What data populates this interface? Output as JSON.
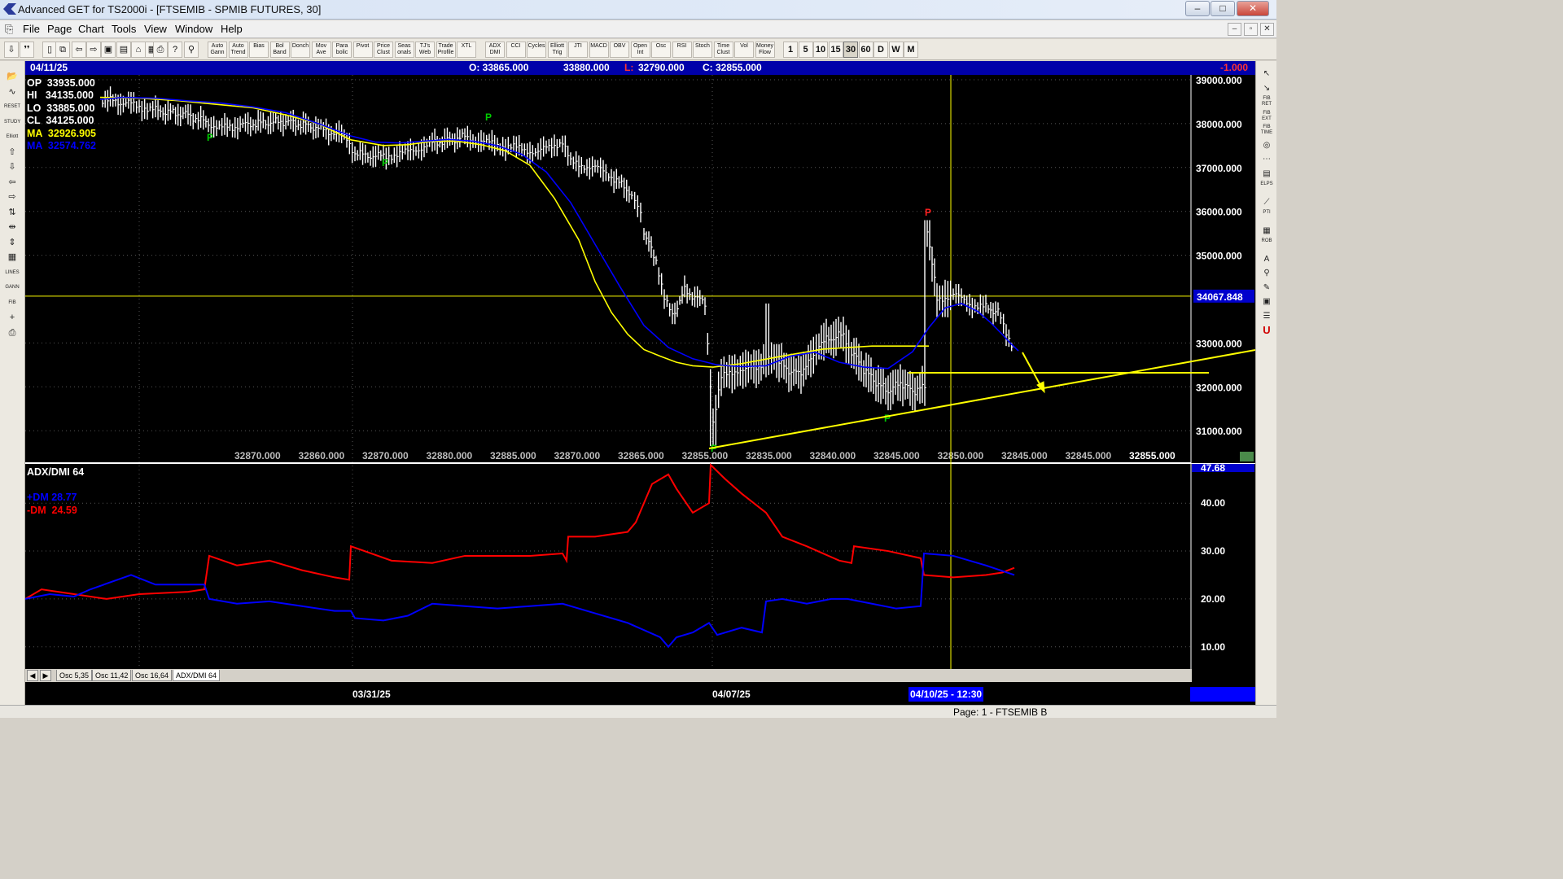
{
  "window": {
    "title": "Advanced GET for TS2000i - [FTSEMIB - SPMIB FUTURES, 30]",
    "min": "–",
    "max": "□",
    "close": "✕"
  },
  "menu": {
    "items": [
      "File",
      "Page",
      "Chart",
      "Tools",
      "View",
      "Window",
      "Help"
    ],
    "mdi": [
      "–",
      "▫",
      "✕"
    ]
  },
  "toolbar": {
    "icons": [
      "⇩",
      "❜❜",
      "▯",
      "⧉",
      "⇦",
      "⇨",
      "▣",
      "▤",
      "⌂",
      "▦",
      "⎙",
      "?",
      "⚲"
    ],
    "studies": [
      "Auto Gann",
      "Auto Trend",
      "Bias",
      "Bol Band",
      "Donch",
      "Mov Ave",
      "Para bolic",
      "Pivot",
      "Price Clust",
      "Seas onals",
      "TJ's Web",
      "Trade Profile",
      "XTL",
      "ADX DMI",
      "CCI",
      "Cycles",
      "Elliott Trig",
      "JTI",
      "MACD",
      "OBV",
      "Open Int",
      "Osc",
      "RSI",
      "Stoch",
      "Time Clust",
      "Vol",
      "Money Flow"
    ],
    "timeframes": [
      "1",
      "5",
      "10",
      "15",
      "30",
      "60",
      "D",
      "W",
      "M"
    ],
    "active_timeframe": "30"
  },
  "left_tools": [
    "📂",
    "∿",
    "RESET",
    "STUDY",
    "Elliott",
    "⇧",
    "⇩",
    "⇦",
    "⇨",
    "⇅",
    "⇹",
    "⇕",
    "▦",
    "LINES",
    "GANN",
    "FIB",
    "+",
    "⎙"
  ],
  "right_tools": [
    "↖",
    "↘",
    "FIB RET",
    "FIB EXT",
    "FIB TIME",
    "◎",
    "⋯",
    "▤",
    "ELPS",
    "⟋",
    "PTI",
    "▦",
    "ROB",
    "A",
    "⚲",
    "✎",
    "▣",
    "☰",
    "U"
  ],
  "header": {
    "date": "04/11/25",
    "open": "O: 33865.000",
    "high": "33880.000",
    "low_label": "L:",
    "low": "32790.000",
    "close": "C: 32855.000",
    "change": "-1.000"
  },
  "readout": {
    "op": "OP  33935.000",
    "hi": "HI   34135.000",
    "lo": "LO  33885.000",
    "cl": "CL  34125.000",
    "ma1": "MA  32926.905",
    "ma2": "MA  32574.762"
  },
  "price_axis": [
    "39000.000",
    "38000.000",
    "37000.000",
    "36000.000",
    "35000.000",
    "34067.848",
    "33000.000",
    "32000.000",
    "31000.000"
  ],
  "bottom_values": [
    "32870.000",
    "32860.000",
    "32870.000",
    "32880.000",
    "32885.000",
    "32870.000",
    "32865.000",
    "32855.000",
    "32835.000",
    "32840.000",
    "32845.000",
    "32850.000",
    "32845.000",
    "32845.000",
    "32855.000"
  ],
  "pivot_label": "P",
  "indicator": {
    "title": "ADX/DMI 64",
    "plus_dm": "+DM 28.77",
    "minus_dm": "-DM  24.59",
    "axis": [
      "47.68",
      "40.00",
      "30.00",
      "20.00",
      "10.00"
    ]
  },
  "tabs": [
    "Osc 5,35",
    "Osc 11,42",
    "Osc 16,64",
    "ADX/DMI 64"
  ],
  "tab_nav": [
    "◀",
    "▶"
  ],
  "dates": {
    "d1": "03/31/25",
    "d2": "04/07/25",
    "cursor": "04/10/25 - 12:30"
  },
  "status": {
    "page": "Page: 1 - FTSEMIB B"
  },
  "colors": {
    "price_bar": "#ffffff",
    "ma_fast": "#ffff00",
    "ma_slow": "#0000ff",
    "plus_dm": "#0000ff",
    "minus_dm": "#ff0000",
    "trendline": "#ffff00",
    "cursor": "#ffff00",
    "pivot_high": "#00cc00"
  },
  "chart_data": {
    "type": "line",
    "price_range": [
      30500,
      39000
    ],
    "cursor_price": 34067.848,
    "series": [
      {
        "name": "MA",
        "values": [
          38600,
          38580,
          38520,
          38430,
          38360,
          38200,
          38000,
          37630,
          37500,
          37520,
          37600,
          37600,
          37520,
          37380,
          37050,
          36300,
          35350,
          34400,
          33700,
          33200,
          32850,
          32700,
          32560,
          32480,
          32450,
          32530,
          32700,
          32860,
          32930,
          32930
        ]
      },
      {
        "name": "MA",
        "values": [
          38550,
          38600,
          38580,
          38520,
          38470,
          38380,
          38250,
          38000,
          37720,
          37580,
          37560,
          37600,
          37640,
          37600,
          37500,
          37300,
          36900,
          36200,
          35250,
          34300,
          33400,
          32900,
          32640,
          32500,
          32460,
          32480,
          32700,
          32790,
          32560,
          32450,
          32420,
          32800,
          33350,
          33800,
          33900,
          33720,
          33480,
          33200,
          33000,
          32820
        ]
      }
    ],
    "adx": {
      "range": [
        5,
        48
      ],
      "plus_dm_last": 28.77,
      "minus_dm_last": 24.59
    }
  }
}
